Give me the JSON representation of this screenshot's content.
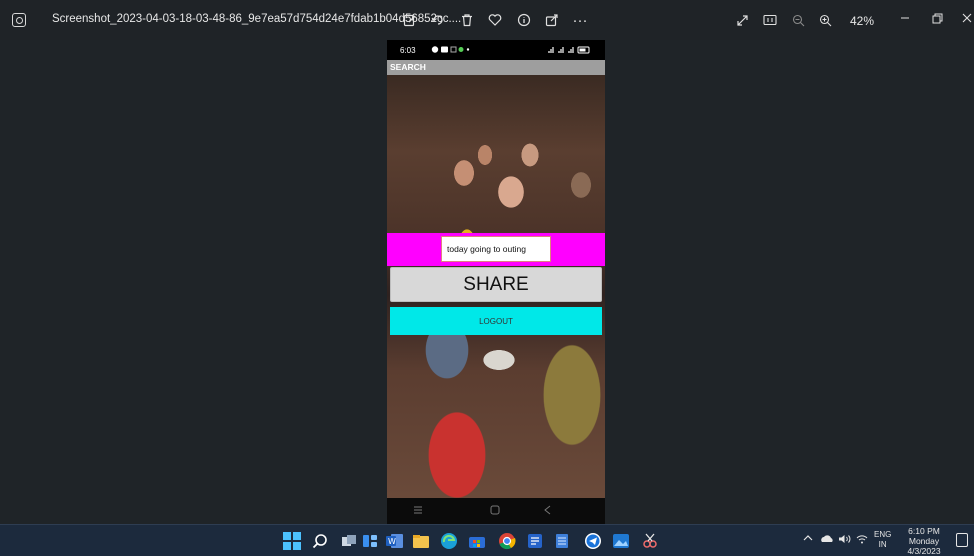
{
  "viewer": {
    "filename": "Screenshot_2023-04-03-18-03-48-86_9e7ea57d754d24e7fdab1b04d56852cc....",
    "zoom_level": "42%",
    "toolbar_icons": [
      "edit-icon",
      "rotate-icon",
      "delete-icon",
      "favorite-icon",
      "info-icon",
      "share-icon",
      "more-icon"
    ],
    "right_icons": [
      "fullscreen-icon",
      "actual-size-icon",
      "zoom-out-icon",
      "zoom-in-icon"
    ],
    "more_glyph": "···"
  },
  "phone": {
    "status_time": "6:03",
    "status_right": "Vo) .ıl ᵛᵒ⁾.ıl",
    "appbar_title": "SEARCH",
    "message_value": "today going to outing",
    "share_label": "SHARE",
    "logout_label": "LOGOUT",
    "nav_icons": [
      "menu-icon",
      "home-icon",
      "back-icon"
    ]
  },
  "taskbar": {
    "lang_top": "ENG",
    "lang_bottom": "IN",
    "time": "6:10 PM",
    "day": "Monday",
    "date": "4/3/2023",
    "colors": {
      "accent": "#4cc2ff",
      "background": "#1c2a3d"
    }
  },
  "colors": {
    "pink_bar": "#ff00ff",
    "logout_bg": "#00e8e8",
    "appbar_bg": "#9e9e9e"
  }
}
